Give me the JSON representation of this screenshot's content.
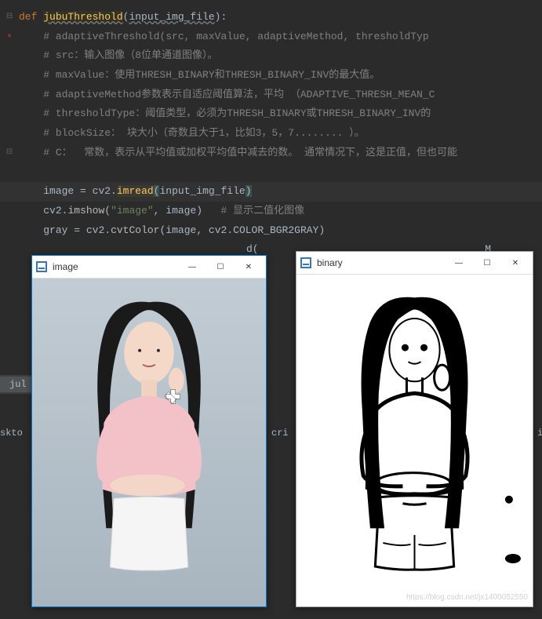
{
  "code": {
    "def": "def",
    "fn": "jubuThreshold",
    "paramsOpen": "(",
    "param": "input_img_file",
    "paramsClose": "):",
    "c1": "# adaptiveThreshold(src, maxValue, adaptiveMethod, thresholdTyp",
    "c2": "# src：输入图像（8位单通道图像）。",
    "c3": "# maxValue：使用THRESH_BINARY和THRESH_BINARY_INV的最大值。",
    "c4": "# adaptiveMethod参数表示自适应阈值算法，平均 （ADAPTIVE_THRESH_MEAN_C",
    "c5": "# thresholdType：阈值类型，必须为THRESH_BINARY或THRESH_BINARY_INV的",
    "c6": "# blockSize： 块大小（奇数且大于1，比如3，5，7........ ）。",
    "c7": "# C：  常数，表示从平均值或加权平均值中减去的数。 通常情况下，这是正值，但也可能",
    "l_image": "image",
    "eq": " = ",
    "l_cv2": "cv2",
    "dot": ".",
    "imread": "imread",
    "open": "(",
    "arg1": "input_img_file",
    "close": ")",
    "imshow": "imshow",
    "str_image": "\"image\"",
    "comma": ", ",
    "comment_show": "# 显示二值化图像",
    "l_gray": "gray",
    "cvt": "cvtColor",
    "bgr2gray": "COLOR_BGR2GRAY",
    "close2": ")",
    "partial_d": "d(",
    "partial_m": "M"
  },
  "tabs": {
    "left": "jul",
    "cri": "cri",
    "sk": "skto"
  },
  "window1": {
    "title": "image"
  },
  "window2": {
    "title": "binary"
  },
  "watermark": "https://blog.csdn.net/jx1400052550"
}
